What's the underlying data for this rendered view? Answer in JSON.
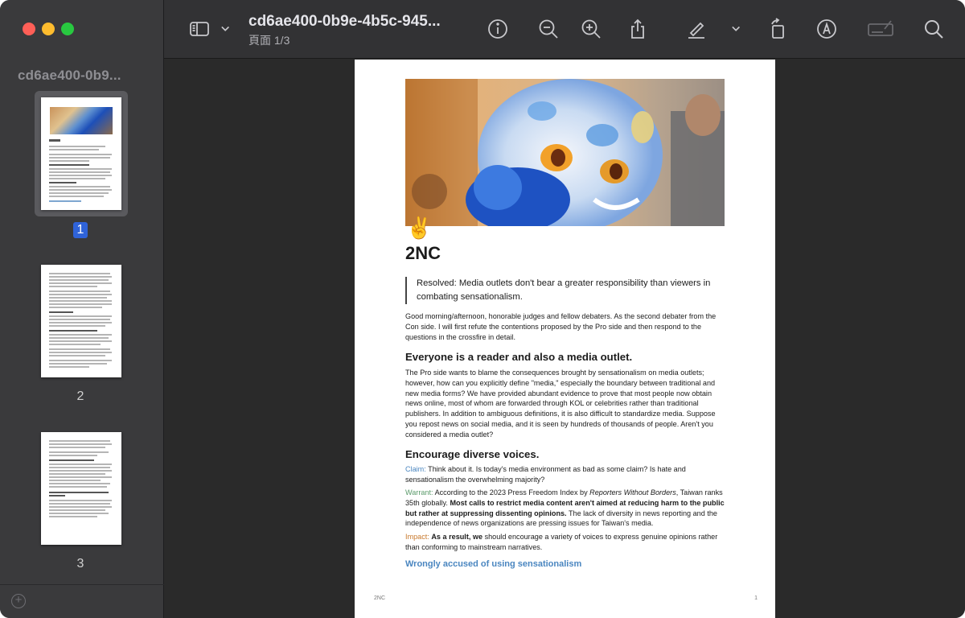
{
  "window": {
    "doc_title": "cd6ae400-0b9e-4b5c-945...",
    "page_indicator": "頁面 1/3"
  },
  "sidebar": {
    "title": "cd6ae400-0b9...",
    "pages": [
      {
        "label": "1",
        "selected": true
      },
      {
        "label": "2",
        "selected": false
      },
      {
        "label": "3",
        "selected": false
      }
    ],
    "add_icon": "plus-circle-icon"
  },
  "toolbar": {
    "icons": [
      "sidebar-toggle-icon",
      "chevron-down-icon",
      "info-icon",
      "zoom-out-icon",
      "zoom-in-icon",
      "share-icon",
      "highlighter-icon",
      "chevron-down-icon",
      "rotate-icon",
      "markup-pen-icon",
      "signature-icon",
      "search-icon"
    ]
  },
  "document": {
    "emoji": "✌️",
    "heading": "2NC",
    "resolution": "Resolved: Media outlets don't bear a greater responsibility than viewers in combating sensationalism.",
    "intro": "Good morning/afternoon, honorable judges and fellow debaters. As the second debater from the Con side. I will first refute the contentions proposed by the Pro side and then respond to the questions in the crossfire in detail.",
    "section1_title": "Everyone is a reader and also a media outlet.",
    "section1_body": "The Pro side wants to blame the consequences brought by sensationalism on media outlets; however, how can you explicitly define \"media,\" especially the boundary between traditional and new media forms? We have provided abundant evidence to prove that most people now obtain news online, most of whom are forwarded through KOL or celebrities rather than traditional publishers. In addition to ambiguous definitions, it is also difficult to standardize media. Suppose you repost news on social media, and it is seen by hundreds of thousands of people. Aren't you considered a media outlet?",
    "section2_title": "Encourage diverse voices.",
    "claim_label": "Claim:",
    "claim_text": "Think about it. Is today's media environment as bad as some claim? Is hate and sensationalism the overwhelming majority?",
    "warrant_label": "Warrant:",
    "warrant_text_1": "According to the 2023 Press Freedom Index by",
    "warrant_italic": "Reporters Without Borders",
    "warrant_text_2": ", Taiwan ranks 35th globally.",
    "warrant_bold": "Most calls to restrict media content aren't aimed at reducing harm to the public but rather at suppressing dissenting opinions.",
    "warrant_text_3": "The lack of diversity in news reporting and the independence of news organizations are pressing issues for Taiwan's media.",
    "impact_label": "Impact:",
    "impact_bold": "As a result, we",
    "impact_text": "should encourage a variety of voices to express genuine opinions rather than conforming to mainstream narratives.",
    "section3_title": "Wrongly accused of using sensationalism",
    "footer_left": "2NC",
    "footer_right": "1"
  }
}
